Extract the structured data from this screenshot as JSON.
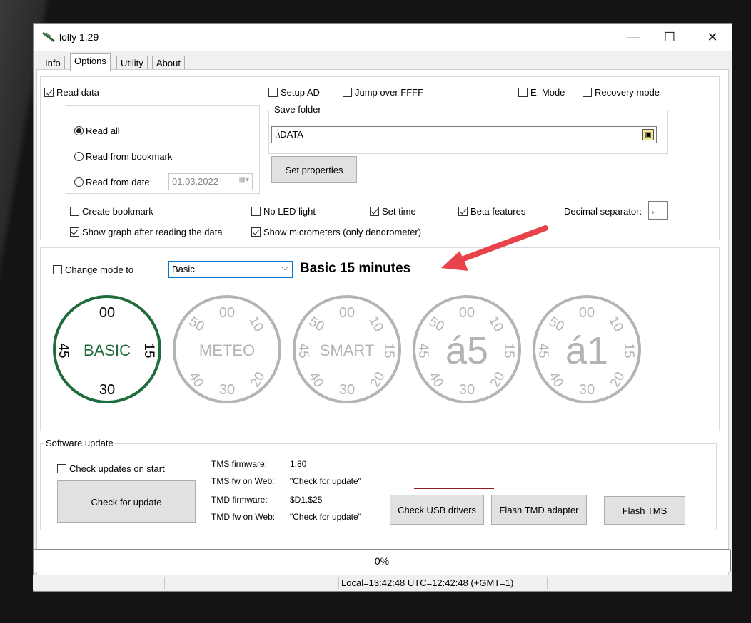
{
  "window": {
    "title": "lolly 1.29",
    "controls": {
      "minimize": "—",
      "maximize": "☐",
      "close": "✕"
    }
  },
  "tabs": [
    {
      "label": "Info",
      "active": false
    },
    {
      "label": "Options",
      "active": true
    },
    {
      "label": "Utility",
      "active": false
    },
    {
      "label": "About",
      "active": false
    }
  ],
  "options": {
    "read_data": {
      "label": "Read data",
      "checked": true
    },
    "read_all": {
      "label": "Read all",
      "selected": true
    },
    "read_bookmark": {
      "label": "Read from bookmark",
      "selected": false
    },
    "read_date": {
      "label": "Read from date",
      "selected": false,
      "date": "01.03.2022"
    },
    "setup_ad": {
      "label": "Setup AD",
      "checked": false
    },
    "jump_ffff": {
      "label": "Jump over FFFF",
      "checked": false
    },
    "e_mode": {
      "label": "E. Mode",
      "checked": false
    },
    "recovery_mode": {
      "label": "Recovery mode",
      "checked": false
    },
    "save_folder": {
      "legend": "Save folder",
      "value": ".\\DATA"
    },
    "set_properties": "Set properties",
    "create_bookmark": {
      "label": "Create bookmark",
      "checked": false
    },
    "no_led": {
      "label": "No LED light",
      "checked": false
    },
    "set_time": {
      "label": "Set time",
      "checked": true
    },
    "beta_features": {
      "label": "Beta features",
      "checked": true
    },
    "decimal_separator": {
      "label": "Decimal separator:",
      "value": ","
    },
    "show_graph": {
      "label": "Show graph after reading the data",
      "checked": true
    },
    "show_micrometers": {
      "label": "Show micrometers (only dendrometer)",
      "checked": true
    }
  },
  "mode": {
    "change_mode": {
      "label": "Change mode to",
      "checked": false
    },
    "select_value": "Basic",
    "description": "Basic 15 minutes",
    "active_color": "#1e6b3c",
    "inactive_color": "#b4b4b4",
    "dials": [
      {
        "center": "BASIC",
        "top": "00",
        "right": "15",
        "bottom": "30",
        "left": "45",
        "active": true
      },
      {
        "center": "METEO",
        "top": "00",
        "top_left": "50",
        "top_right": "10",
        "bottom": "30",
        "bottom_left": "40",
        "bottom_right": "20",
        "active": false
      },
      {
        "center": "SMART",
        "top": "00",
        "top_left": "50",
        "top_right": "10",
        "right": "15",
        "bottom": "30",
        "left": "45",
        "bottom_left": "40",
        "bottom_right": "20",
        "active": false
      },
      {
        "center": "á5",
        "top": "00",
        "top_left": "50",
        "top_right": "10",
        "right": "15",
        "bottom": "30",
        "left": "45",
        "bottom_left": "40",
        "bottom_right": "20",
        "active": false
      },
      {
        "center": "á1",
        "top": "00",
        "top_left": "50",
        "top_right": "10",
        "right": "15",
        "bottom": "30",
        "left": "45",
        "bottom_left": "40",
        "bottom_right": "20",
        "active": false
      }
    ]
  },
  "software_update": {
    "legend": "Software update",
    "check_on_start": {
      "label": "Check updates on start",
      "checked": false
    },
    "check_button": "Check for update",
    "tms_firmware_label": "TMS firmware:",
    "tms_firmware_value": "1.80",
    "tms_web_label": "TMS fw on Web:",
    "tms_web_value": "\"Check for update\"",
    "tmd_firmware_label": "TMD firmware:",
    "tmd_firmware_value": "$D1.$25",
    "tmd_web_label": "TMD fw on Web:",
    "tmd_web_value": "\"Check for update\"",
    "usb_button": "Check USB drivers",
    "flash_tmd_button": "Flash TMD adapter",
    "flash_tms_button": "Flash TMS"
  },
  "progress": {
    "text": "0%",
    "value": 0
  },
  "statusbar": {
    "time": "Local=13:42:48  UTC=12:42:48 (+GMT=1)"
  },
  "annotation": {
    "color": "#e8424a"
  }
}
